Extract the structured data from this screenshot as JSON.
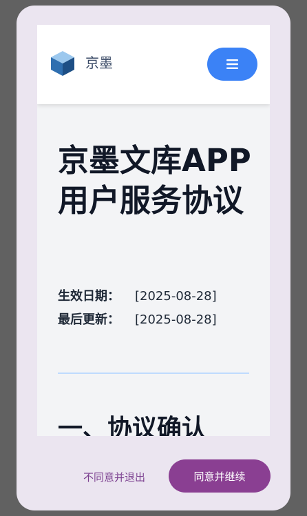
{
  "header": {
    "brand_name": "京墨",
    "logo_icon": "cube-logo-icon",
    "menu_icon": "hamburger-menu-icon",
    "menu_color": "#3b82f6"
  },
  "document": {
    "title": "京墨文库APP用户服务协议",
    "effective_label": "生效日期：",
    "effective_value": "[2025-08-28]",
    "updated_label": "最后更新：",
    "updated_value": "[2025-08-28]",
    "section_heading": "一、协议确认"
  },
  "actions": {
    "reject_label": "不同意并退出",
    "accept_label": "同意并继续",
    "accept_color": "#8a3f92"
  }
}
